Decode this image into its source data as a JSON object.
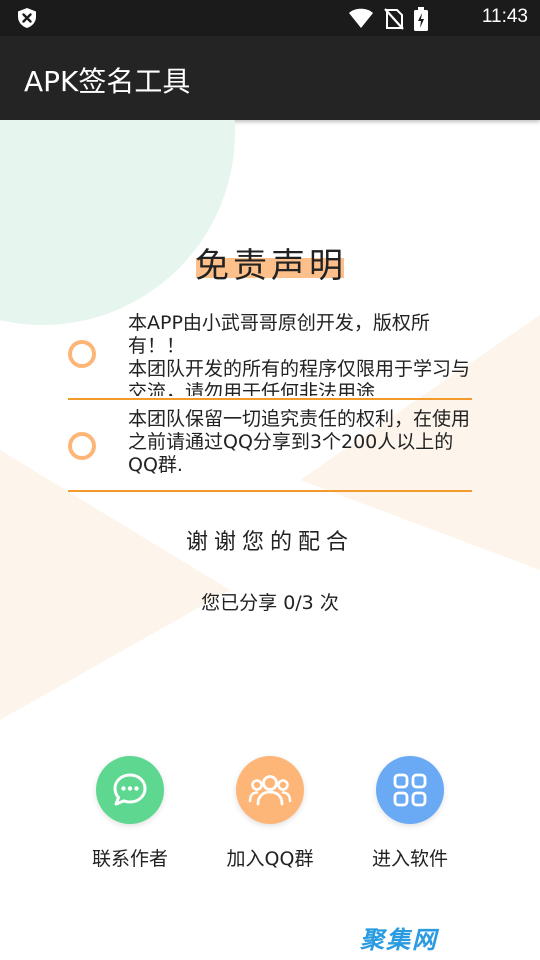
{
  "status_bar": {
    "time": "11:43",
    "icons": [
      "shield-x-icon",
      "wifi-icon",
      "no-sim-icon",
      "battery-charging-icon"
    ]
  },
  "app_bar": {
    "title": "APK签名工具"
  },
  "disclaimer": {
    "title": "免责声明",
    "notices": [
      {
        "text": "本APP由小武哥哥原创开发，版权所有！！\n本团队开发的所有的程序仅限用于学习与交流，请勿用于任何非法用途"
      },
      {
        "text": "本团队保留一切追究责任的权利，在使用之前请通过QQ分享到3个200人以上的QQ群."
      }
    ],
    "thanks": "谢谢您的配合",
    "share_status": "您已分享 0/3 次"
  },
  "actions": [
    {
      "label": "联系作者",
      "icon": "chat-icon",
      "color": "#5ed890"
    },
    {
      "label": "加入QQ群",
      "icon": "group-icon",
      "color": "#fdb677"
    },
    {
      "label": "进入软件",
      "icon": "apps-grid-icon",
      "color": "#6aaaf5"
    }
  ],
  "watermark": "聚集网"
}
